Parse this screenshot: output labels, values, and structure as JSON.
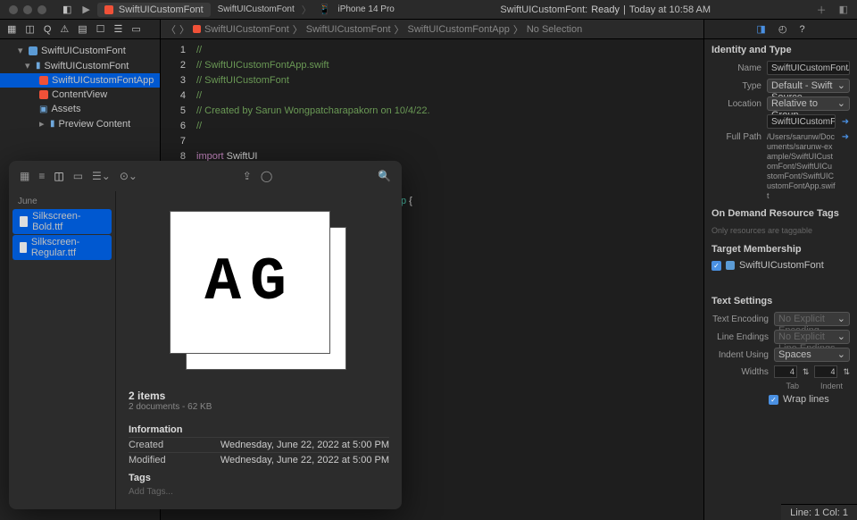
{
  "topbar": {
    "tab_label": "SwiftUICustomFont",
    "breadcrumb_items": [
      "SwiftUICustomFont",
      "iPhone 14 Pro"
    ],
    "status_prefix": "SwiftUICustomFont:",
    "status_state": "Ready",
    "status_time": "Today at 10:58 AM"
  },
  "navigator": {
    "root": "SwiftUICustomFont",
    "group": "SwiftUICustomFont",
    "items": [
      {
        "name": "SwiftUICustomFontApp",
        "selected": true
      },
      {
        "name": "ContentView"
      },
      {
        "name": "Assets"
      },
      {
        "name": "Preview Content",
        "folder": true
      }
    ]
  },
  "breadcrumb": {
    "items": [
      "SwiftUICustomFont",
      "SwiftUICustomFont",
      "SwiftUICustomFontApp",
      "No Selection"
    ]
  },
  "code": {
    "lines": [
      {
        "n": "1",
        "c": "//",
        "cls": "comment"
      },
      {
        "n": "2",
        "c": "//  SwiftUICustomFontApp.swift",
        "cls": "comment"
      },
      {
        "n": "3",
        "c": "//  SwiftUICustomFont",
        "cls": "comment"
      },
      {
        "n": "4",
        "c": "//",
        "cls": "comment"
      },
      {
        "n": "5",
        "c": "//  Created by Sarun Wongpatcharapakorn on 10/4/22.",
        "cls": "comment"
      },
      {
        "n": "6",
        "c": "//",
        "cls": "comment"
      },
      {
        "n": "7",
        "c": "",
        "cls": ""
      },
      {
        "n": "8",
        "c": "",
        "cls": ""
      }
    ],
    "line8": {
      "import": "import",
      "module": "SwiftUI"
    },
    "visible_extra_line": {
      "colon": ":",
      "type": "App",
      "brace": "{"
    }
  },
  "inspector": {
    "identity_title": "Identity and Type",
    "name_label": "Name",
    "name_value": "SwiftUICustomFontApp.swift",
    "type_label": "Type",
    "type_value": "Default - Swift Source",
    "location_label": "Location",
    "location_value": "Relative to Group",
    "filename": "SwiftUICustomFontApp.swift",
    "fullpath_label": "Full Path",
    "fullpath_value": "/Users/sarunw/Documents/sarunw-example/SwiftUICustomFont/SwiftUICustomFont/SwiftUICustomFontApp.swift",
    "ondemand_title": "On Demand Resource Tags",
    "ondemand_hint": "Only resources are taggable",
    "target_title": "Target Membership",
    "target_name": "SwiftUICustomFont",
    "text_title": "Text Settings",
    "encoding_label": "Text Encoding",
    "encoding_value": "No Explicit Encoding",
    "lineendings_label": "Line Endings",
    "lineendings_value": "No Explicit Line Endings",
    "indent_label": "Indent Using",
    "indent_value": "Spaces",
    "widths_label": "Widths",
    "tab_width": "4",
    "indent_width": "4",
    "tab_text": "Tab",
    "indent_text": "Indent",
    "wrap_label": "Wrap lines"
  },
  "statusbar": {
    "position": "Line: 1  Col: 1"
  },
  "finder": {
    "sidebar_title": "June",
    "files": [
      {
        "name": "Silkscreen-Bold.ttf",
        "selected": true
      },
      {
        "name": "Silkscreen-Regular.ttf",
        "selected": true
      }
    ],
    "glyphs": "AG",
    "count_title": "2 items",
    "count_sub": "2 documents - 62 KB",
    "info_title": "Information",
    "created_label": "Created",
    "created_value": "Wednesday, June 22, 2022 at 5:00 PM",
    "modified_label": "Modified",
    "modified_value": "Wednesday, June 22, 2022 at 5:00 PM",
    "tags_title": "Tags",
    "tags_placeholder": "Add Tags..."
  }
}
